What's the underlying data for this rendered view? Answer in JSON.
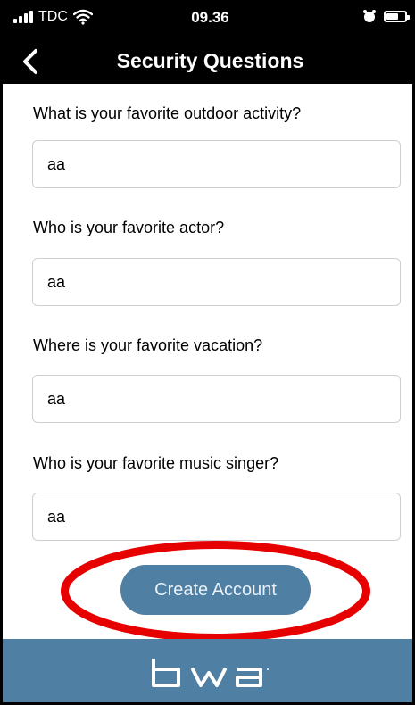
{
  "status_bar": {
    "carrier": "TDC",
    "time": "09.36",
    "battery_level": 0.6
  },
  "nav": {
    "title": "Security Questions",
    "back_icon": "chevron-left-icon"
  },
  "questions": [
    {
      "label": "What is your favorite outdoor activity?",
      "value": "aa"
    },
    {
      "label": "Who is your favorite actor?",
      "value": "aa"
    },
    {
      "label": "Where is your favorite vacation?",
      "value": "aa"
    },
    {
      "label": "Who is your favorite music singer?",
      "value": "aa"
    }
  ],
  "actions": {
    "create_account_label": "Create Account"
  },
  "footer": {
    "logo_text": "bwa"
  },
  "colors": {
    "brand": "#4f7fa3",
    "highlight": "#e60000",
    "bar": "#000000"
  }
}
